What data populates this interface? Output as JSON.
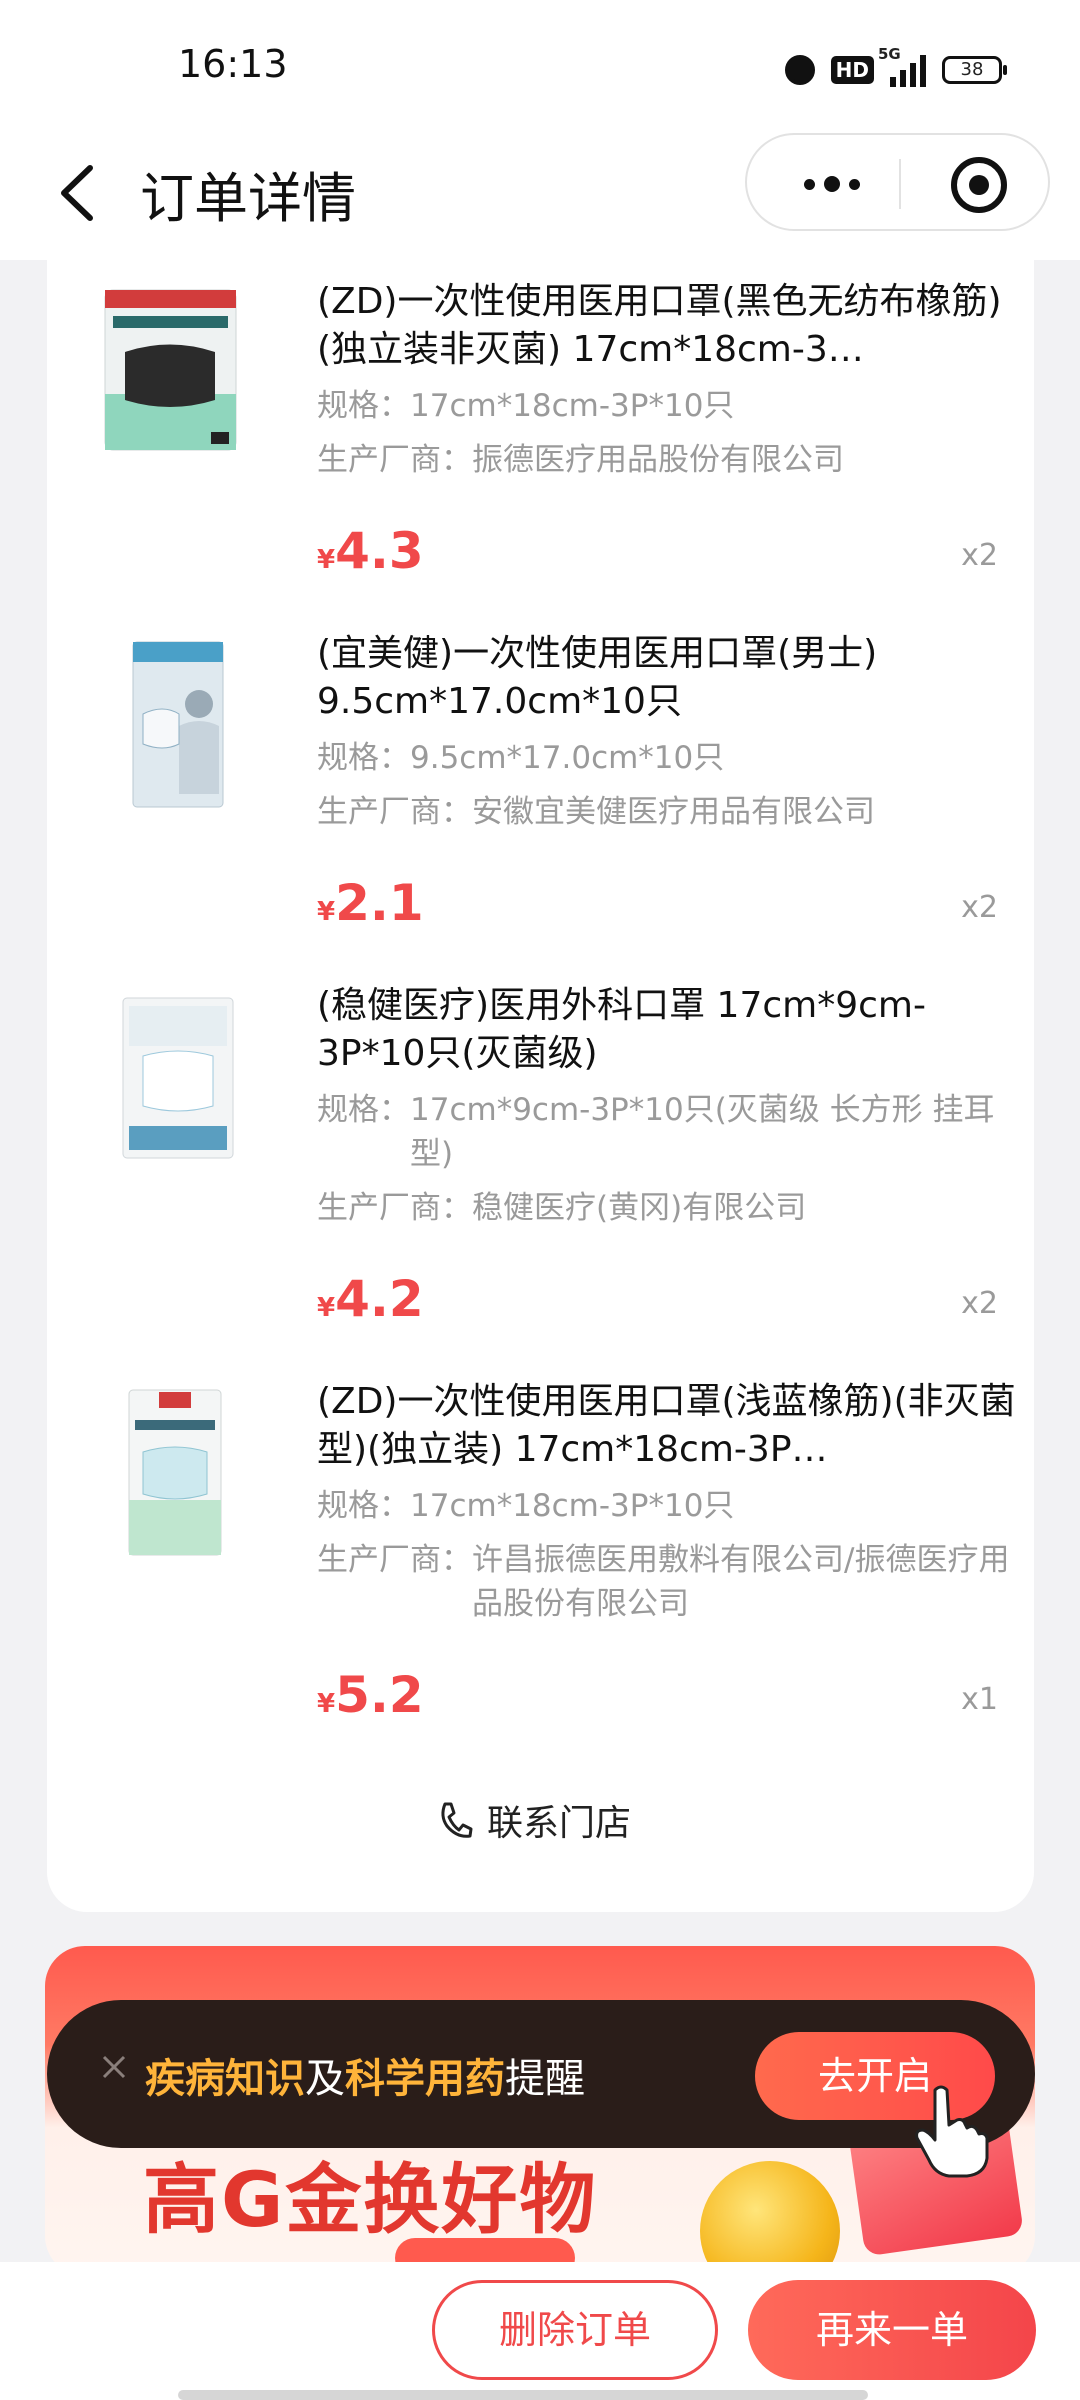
{
  "status_bar": {
    "time": "16:13",
    "network": "5G",
    "hd_label": "HD",
    "battery": "38"
  },
  "nav": {
    "title": "订单详情",
    "icons": [
      "back-icon",
      "more-icon",
      "mini-program-close-icon"
    ]
  },
  "products": [
    {
      "name": "(ZD)一次性使用医用口罩(黑色无纺布橡筋)(独立装非灭菌) 17cm*18cm-3…",
      "spec_label": "规格：",
      "spec": "17cm*18cm-3P*10只",
      "maker_label": "生产厂商：",
      "maker": "振德医疗用品股份有限公司",
      "currency": "¥",
      "price": "4.3",
      "qty": "x2"
    },
    {
      "name": "(宜美健)一次性使用医用口罩(男士) 9.5cm*17.0cm*10只",
      "spec_label": "规格：",
      "spec": "9.5cm*17.0cm*10只",
      "maker_label": "生产厂商：",
      "maker": "安徽宜美健医疗用品有限公司",
      "currency": "¥",
      "price": "2.1",
      "qty": "x2"
    },
    {
      "name": "(稳健医疗)医用外科口罩 17cm*9cm-3P*10只(灭菌级)",
      "spec_label": "规格：",
      "spec": "17cm*9cm-3P*10只(灭菌级 长方形 挂耳型)",
      "maker_label": "生产厂商：",
      "maker": "稳健医疗(黄冈)有限公司",
      "currency": "¥",
      "price": "4.2",
      "qty": "x2"
    },
    {
      "name": "(ZD)一次性使用医用口罩(浅蓝橡筋)(非灭菌型)(独立装) 17cm*18cm-3P…",
      "spec_label": "规格：",
      "spec": "17cm*18cm-3P*10只",
      "maker_label": "生产厂商：",
      "maker": "许昌振德医用敷料有限公司/振德医疗用品股份有限公司",
      "currency": "¥",
      "price": "5.2",
      "qty": "x1"
    }
  ],
  "contact_store": "联系门店",
  "banner": {
    "headline": "高G金换好物"
  },
  "reminder": {
    "part1": "疾病知识",
    "part2": "及",
    "part3": "科学用药",
    "part4": "提醒",
    "button": "去开启"
  },
  "actions": {
    "delete_order": "删除订单",
    "reorder": "再来一单"
  },
  "colors": {
    "accent": "#f0494a",
    "highlight": "#ffb43a",
    "toast_bg": "#2a1d19"
  }
}
